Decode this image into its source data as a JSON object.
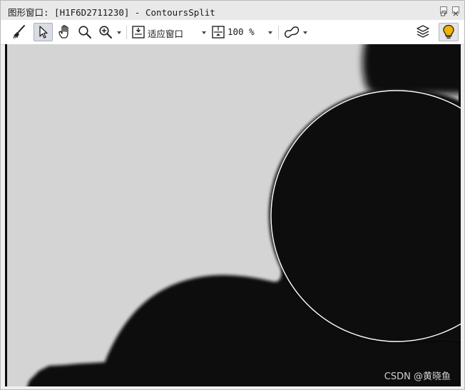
{
  "window": {
    "title": "图形窗口: [H1F6D2711230] - ContoursSplit",
    "restore_icon": "restore-icon",
    "close_icon": "close-icon"
  },
  "toolbar": {
    "tools": [
      {
        "name": "brush",
        "icon": "brush-icon"
      },
      {
        "name": "pointer",
        "icon": "pointer-icon",
        "active": true
      },
      {
        "name": "pan",
        "icon": "hand-icon"
      },
      {
        "name": "zoom",
        "icon": "magnifier-icon"
      },
      {
        "name": "zoom-in",
        "icon": "zoom-in-icon"
      },
      {
        "name": "draw-roi",
        "icon": "roi-shape-icon"
      },
      {
        "name": "layers",
        "icon": "layers-icon"
      },
      {
        "name": "tips",
        "icon": "lightbulb-icon",
        "active": true
      }
    ],
    "fit_label": "适应窗口",
    "zoom_value": "100 %"
  },
  "canvas": {
    "colors": {
      "background_gray": "#d4d4d4",
      "object_black": "#0d0d0d",
      "contour_white": "#ffffff"
    }
  },
  "watermark": {
    "text": "CSDN @黄晓鱼"
  },
  "colors": {
    "titlebar": "#e9e9e9",
    "toolbar": "#ffffff",
    "active_button": "#d9dde3",
    "bulb_yellow": "#f2b300"
  }
}
